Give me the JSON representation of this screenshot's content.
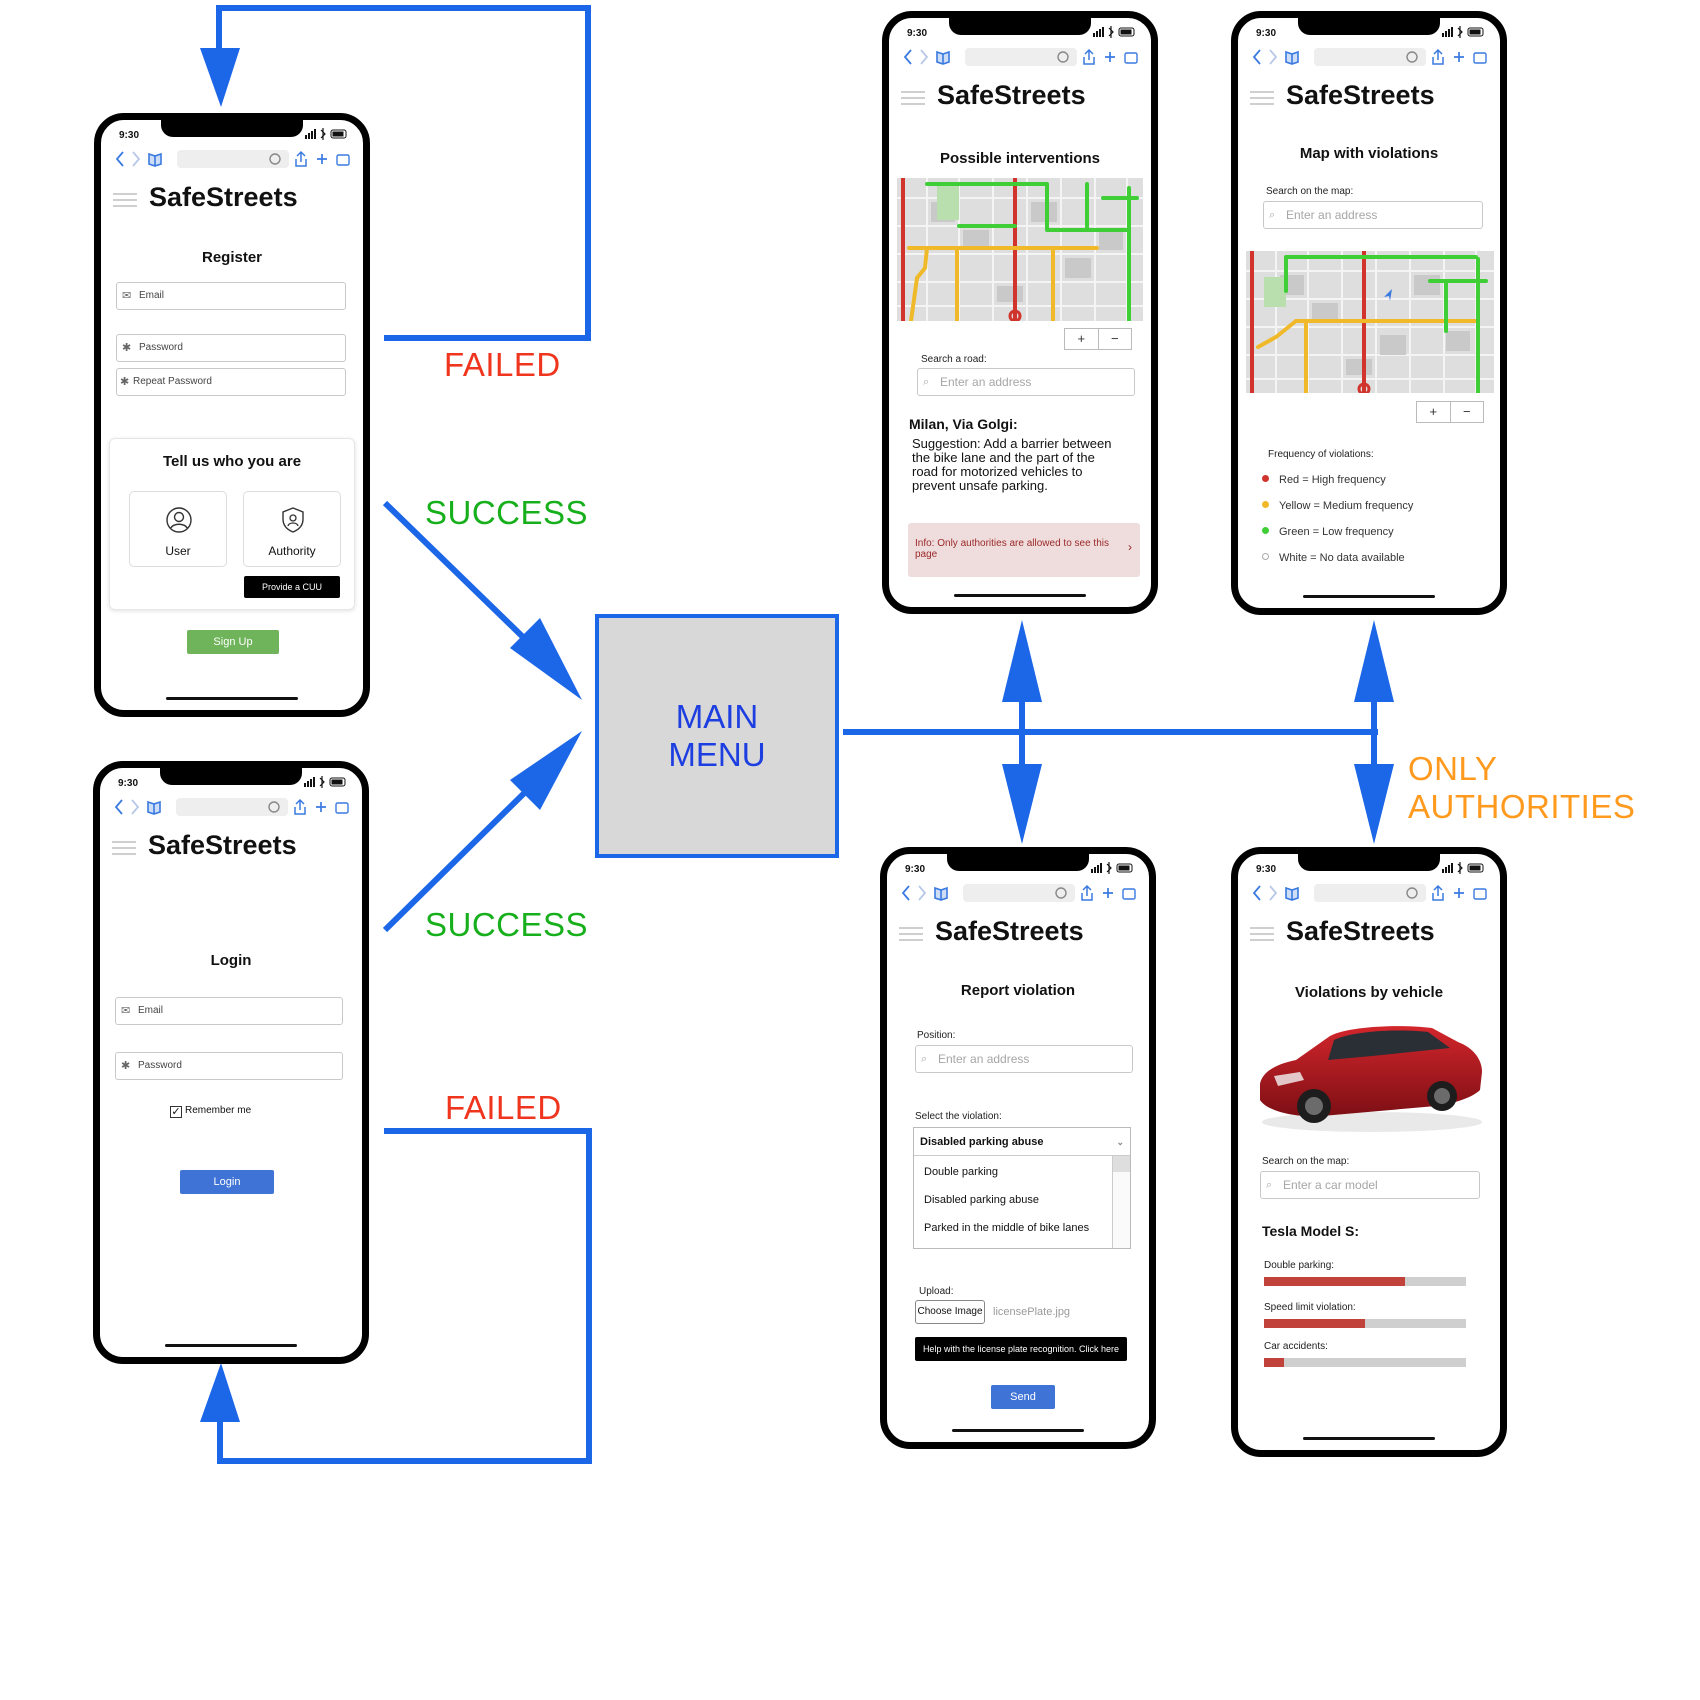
{
  "app_name": "SafeStreets",
  "status_time": "9:30",
  "main_menu": {
    "label": "MAIN\nMENU"
  },
  "flow_labels": {
    "register_failed": "FAILED",
    "register_success": "SUCCESS",
    "login_success": "SUCCESS",
    "login_failed": "FAILED",
    "only_authorities": "ONLY\nAUTHORITIES"
  },
  "colors": {
    "arrow": "#1c66e8",
    "failed": "#f0351f",
    "success": "#17b01c",
    "only_authorities": "#ff9a1e",
    "signup_button": "#6fb45a",
    "primary_button": "#3f73d6",
    "map_red": "#d0342c",
    "map_yellow": "#f0b92a",
    "map_green": "#3fce35",
    "bar_fill": "#c0423a"
  },
  "register_screen": {
    "title": "Register",
    "email_placeholder": "Email",
    "password_placeholder": "Password",
    "repeat_password_placeholder": "Repeat Password",
    "who_title": "Tell us who you are",
    "user_label": "User",
    "authority_label": "Authority",
    "tooltip": "Provide a CUU",
    "signup_button": "Sign Up"
  },
  "login_screen": {
    "title": "Login",
    "email_placeholder": "Email",
    "password_placeholder": "Password",
    "remember_label": "Remember me",
    "remember_checked": true,
    "login_button": "Login"
  },
  "interventions_screen": {
    "title": "Possible interventions",
    "search_label": "Search a road:",
    "search_placeholder": "Enter an address",
    "zoom_in": "+",
    "zoom_out": "−",
    "location": "Milan, Via Golgi:",
    "suggestion": "Suggestion: Add a barrier between the bike lane and the part of the road for motorized vehicles to prevent unsafe parking.",
    "info": "Info: Only authorities are allowed to see this page",
    "info_chevron": "›"
  },
  "violations_map_screen": {
    "title": "Map with violations",
    "search_label": "Search on the map:",
    "search_placeholder": "Enter an address",
    "zoom_in": "+",
    "zoom_out": "−",
    "legend_title": "Frequency of violations:",
    "legend": [
      {
        "label": "Red = High frequency",
        "color": "#d0342c"
      },
      {
        "label": "Yellow = Medium frequency",
        "color": "#f0b92a"
      },
      {
        "label": "Green = Low frequency",
        "color": "#3fce35"
      },
      {
        "label": "White = No data available",
        "color": "#ffffff"
      }
    ]
  },
  "report_screen": {
    "title": "Report violation",
    "position_label": "Position:",
    "position_placeholder": "Enter an address",
    "violation_label": "Select the violation:",
    "selected_violation": "Disabled parking abuse",
    "options": [
      "Double parking",
      "Disabled parking abuse",
      "Parked in the middle of bike lanes"
    ],
    "upload_label": "Upload:",
    "choose_button": "Choose Image",
    "file_name": "licensePlate.jpg",
    "tooltip": "Help with the license plate recognition. Click here",
    "send_button": "Send"
  },
  "vehicle_screen": {
    "title": "Violations by vehicle",
    "search_label": "Search on the map:",
    "search_placeholder": "Enter a car model",
    "model": "Tesla Model S:",
    "bars": [
      {
        "label": "Double parking:",
        "fraction": 0.7
      },
      {
        "label": "Speed limit violation:",
        "fraction": 0.5
      },
      {
        "label": "Car accidents:",
        "fraction": 0.1
      }
    ]
  }
}
